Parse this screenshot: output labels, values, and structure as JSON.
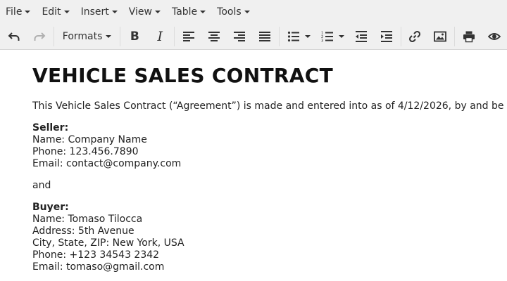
{
  "menu": {
    "file": "File",
    "edit": "Edit",
    "insert": "Insert",
    "view": "View",
    "table": "Table",
    "tools": "Tools"
  },
  "toolbar": {
    "formats_label": "Formats",
    "icons": [
      "undo-icon",
      "redo-icon",
      "bold-icon",
      "italic-icon",
      "align-left-icon",
      "align-center-icon",
      "align-right-icon",
      "justify-icon",
      "bullet-list-icon",
      "numbered-list-icon",
      "outdent-icon",
      "indent-icon",
      "link-icon",
      "image-icon",
      "print-icon",
      "preview-icon"
    ]
  },
  "document": {
    "title": "VEHICLE SALES CONTRACT",
    "intro": "This Vehicle Sales Contract (“Agreement”) is made and entered into as of 4/12/2026, by and be",
    "seller": {
      "heading": "Seller:",
      "name": "Name: Company Name",
      "phone": "Phone: 123.456.7890",
      "email": "Email: contact@company.com"
    },
    "and": "and",
    "buyer": {
      "heading": "Buyer:",
      "name": "Name: Tomaso Tilocca",
      "address": "Address: 5th Avenue",
      "city": "City, State, ZIP: New York, USA",
      "phone": "Phone: +123 34543 2342",
      "email": "Email: tomaso@gmail.com"
    }
  }
}
